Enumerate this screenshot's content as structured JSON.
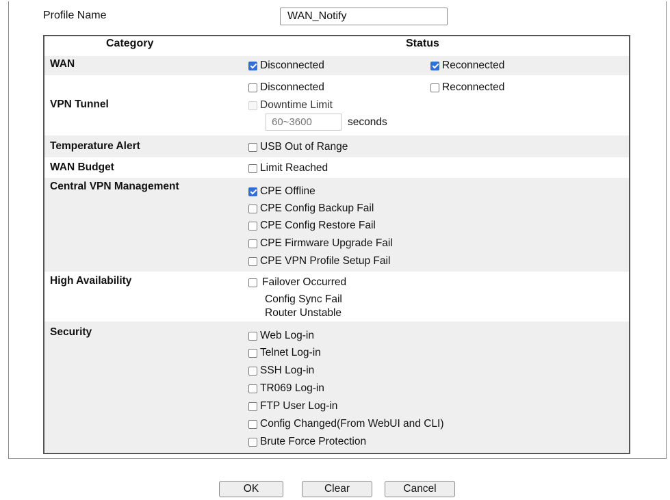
{
  "profile": {
    "label": "Profile Name",
    "value": "WAN_Notify"
  },
  "table": {
    "header_category": "Category",
    "header_status": "Status",
    "wan": {
      "label": "WAN",
      "disconnected": {
        "label": "Disconnected",
        "checked": true
      },
      "reconnected": {
        "label": "Reconnected",
        "checked": true
      }
    },
    "vpn_tunnel": {
      "label": "VPN Tunnel",
      "disconnected": {
        "label": "Disconnected",
        "checked": false
      },
      "reconnected": {
        "label": "Reconnected",
        "checked": false
      },
      "downtime_limit": {
        "label": "Downtime Limit",
        "checked": false,
        "disabled": true
      },
      "range_placeholder": "60~3600",
      "seconds_label": "seconds"
    },
    "temperature_alert": {
      "label": "Temperature Alert",
      "usb_out_of_range": {
        "label": "USB Out of Range",
        "checked": false
      }
    },
    "wan_budget": {
      "label": "WAN Budget",
      "limit_reached": {
        "label": "Limit Reached",
        "checked": false
      }
    },
    "central_vpn": {
      "label": "Central VPN Management",
      "items": [
        {
          "label": "CPE Offline",
          "checked": true
        },
        {
          "label": "CPE Config Backup Fail",
          "checked": false
        },
        {
          "label": "CPE Config Restore Fail",
          "checked": false
        },
        {
          "label": "CPE Firmware Upgrade Fail",
          "checked": false
        },
        {
          "label": "CPE VPN Profile Setup Fail",
          "checked": false
        }
      ]
    },
    "high_availability": {
      "label": "High Availability",
      "failover": {
        "label": "Failover Occurred",
        "checked": false
      },
      "config_sync_fail": "Config Sync Fail",
      "router_unstable": "Router Unstable"
    },
    "security": {
      "label": "Security",
      "items": [
        {
          "label": "Web Log-in",
          "checked": false
        },
        {
          "label": "Telnet Log-in",
          "checked": false
        },
        {
          "label": "SSH Log-in",
          "checked": false
        },
        {
          "label": "TR069 Log-in",
          "checked": false
        },
        {
          "label": "FTP User Log-in",
          "checked": false
        },
        {
          "label": "Config Changed(From WebUI and CLI)",
          "checked": false
        },
        {
          "label": "Brute Force Protection",
          "checked": false
        }
      ]
    }
  },
  "buttons": {
    "ok": "OK",
    "clear": "Clear",
    "cancel": "Cancel"
  },
  "colors": {
    "checkbox_accent": "#2f6fd6",
    "row_band": "#efefef"
  }
}
